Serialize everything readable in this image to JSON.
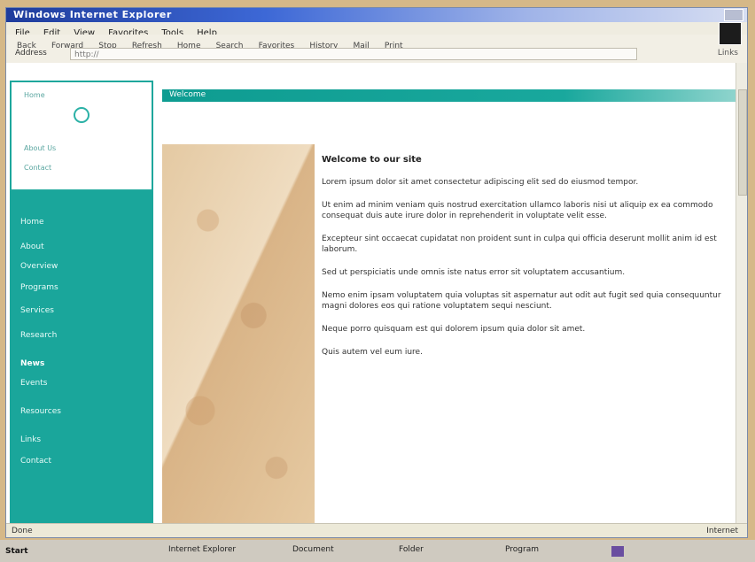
{
  "window": {
    "title": "Windows Internet Explorer",
    "menu": [
      "File",
      "Edit",
      "View",
      "Favorites",
      "Tools",
      "Help"
    ],
    "toolbar": [
      "Back",
      "Forward",
      "Stop",
      "Refresh",
      "Home",
      "Search",
      "Favorites",
      "History",
      "Mail",
      "Print"
    ],
    "address_label": "Address",
    "address_value": "http://",
    "links_label": "Links"
  },
  "sidebar": {
    "logo_lines": [
      "Home",
      "About Us",
      "Contact"
    ],
    "items": [
      {
        "label": "Home"
      },
      {
        "label": "About"
      },
      {
        "label": "Overview"
      },
      {
        "label": "Programs"
      },
      {
        "label": "Services"
      },
      {
        "label": "Research"
      },
      {
        "label": "News"
      },
      {
        "label": "Events"
      },
      {
        "label": "Resources"
      },
      {
        "label": "Links"
      },
      {
        "label": "Contact"
      }
    ]
  },
  "content": {
    "header": "Welcome",
    "title": "Welcome to our site",
    "paragraphs": [
      "Lorem ipsum dolor sit amet consectetur adipiscing elit sed do eiusmod tempor.",
      "Ut enim ad minim veniam quis nostrud exercitation ullamco laboris nisi ut aliquip ex ea commodo consequat duis aute irure dolor in reprehenderit in voluptate velit esse.",
      "Excepteur sint occaecat cupidatat non proident sunt in culpa qui officia deserunt mollit anim id est laborum.",
      "Sed ut perspiciatis unde omnis iste natus error sit voluptatem accusantium.",
      "Nemo enim ipsam voluptatem quia voluptas sit aspernatur aut odit aut fugit sed quia consequuntur magni dolores eos qui ratione voluptatem sequi nesciunt.",
      "Neque porro quisquam est qui dolorem ipsum quia dolor sit amet.",
      "Quis autem vel eum iure."
    ]
  },
  "status": {
    "left": "Done",
    "right": "Internet"
  },
  "taskbar": {
    "start": "Start",
    "items": [
      "Internet Explorer",
      "Document",
      "Folder",
      "Program"
    ]
  },
  "colors": {
    "accent": "#1aa69b",
    "title_bar": "#3d68d6"
  }
}
